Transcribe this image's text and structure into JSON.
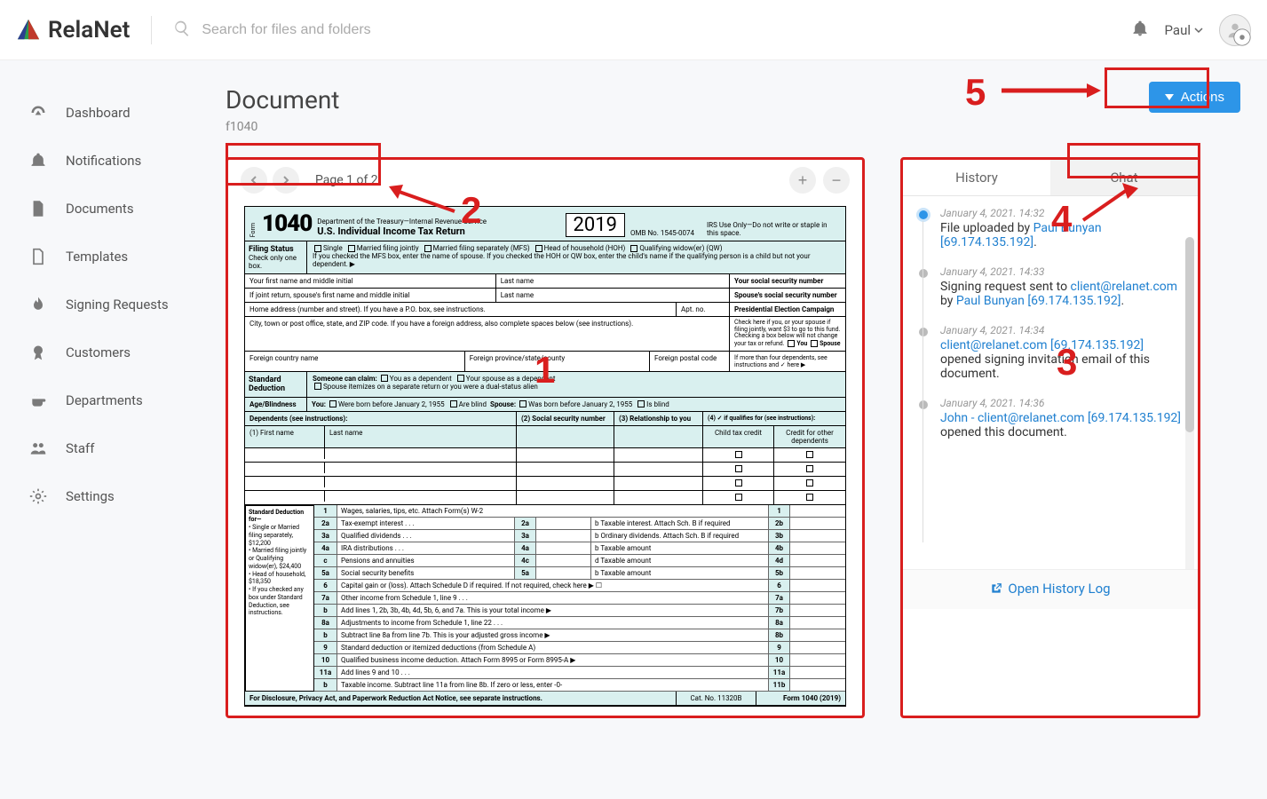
{
  "brand": "RelaNet",
  "search_placeholder": "Search for files and folders",
  "user_name": "Paul",
  "sidebar": {
    "items": [
      {
        "label": "Dashboard"
      },
      {
        "label": "Notifications"
      },
      {
        "label": "Documents"
      },
      {
        "label": "Templates"
      },
      {
        "label": "Signing Requests"
      },
      {
        "label": "Customers"
      },
      {
        "label": "Departments"
      },
      {
        "label": "Staff"
      },
      {
        "label": "Settings"
      }
    ]
  },
  "page": {
    "title": "Document",
    "subtitle": "f1040"
  },
  "actions_label": "Actions",
  "viewer": {
    "page_label": "Page 1 of 2"
  },
  "form1040": {
    "form_number_prefix": "Form",
    "form_number": "1040",
    "dept": "Department of the Treasury—Internal Revenue Service",
    "title": "U.S. Individual Income Tax Return",
    "year": "2019",
    "omb": "OMB No. 1545-0074",
    "irs_note": "IRS Use Only—Do not write or staple in this space.",
    "filing_status_label": "Filing Status",
    "filing_status_note": "Check only one box.",
    "filing_options": "Single    Married filing jointly    Married filing separately (MFS)    Head of household (HOH)    Qualifying widow(er) (QW)",
    "filing_explain": "If you checked the MFS box, enter the name of spouse. If you checked the HOH or QW box, enter the child's name if the qualifying person is a child but not your dependent. ▶",
    "first_name": "Your first name and middle initial",
    "last_name": "Last name",
    "ssn": "Your social security number",
    "spouse_first": "If joint return, spouse's first name and middle initial",
    "spouse_last": "Last name",
    "spouse_ssn": "Spouse's social security number",
    "address": "Home address (number and street). If you have a P.O. box, see instructions.",
    "apt": "Apt. no.",
    "pres_campaign": "Presidential Election Campaign",
    "pres_text": "Check here if you, or your spouse if filing jointly, want $3 to go to this fund. Checking a box below will not change your tax or refund.",
    "pres_you": "You",
    "pres_spouse": "Spouse",
    "city": "City, town or post office, state, and ZIP code. If you have a foreign address, also complete spaces below (see instructions).",
    "foreign_country": "Foreign country name",
    "foreign_prov": "Foreign province/state/county",
    "foreign_postal": "Foreign postal code",
    "more_dep": "If more than four dependents, see instructions and ✓ here ▶",
    "std_ded_label": "Standard Deduction",
    "someone_claim": "Someone can claim:",
    "you_dep": "You as a dependent",
    "spouse_dep": "Your spouse as a dependent",
    "itemize": "Spouse itemizes on a separate return or you were a dual-status alien",
    "age_blind": "Age/Blindness",
    "age_you": "You:",
    "born_before": "Were born before January 2, 1955",
    "are_blind": "Are blind",
    "age_spouse": "Spouse:",
    "was_born": "Was born before January 2, 1955",
    "is_blind": "Is blind",
    "dependents_label": "Dependents (see instructions):",
    "dep_first": "(1) First name",
    "dep_last": "Last name",
    "dep_ssn": "(2) Social security number",
    "dep_rel": "(3) Relationship to you",
    "dep_qual": "(4) ✓ if qualifies for (see instructions):",
    "dep_ctc": "Child tax credit",
    "dep_other": "Credit for other dependents",
    "ded_sidebar_title": "Standard Deduction for—",
    "ded_sidebar_1": "• Single or Married filing separately, $12,200",
    "ded_sidebar_2": "• Married filing jointly or Qualifying widow(er), $24,400",
    "ded_sidebar_3": "• Head of household, $18,350",
    "ded_sidebar_4": "• If you checked any box under Standard Deduction, see instructions.",
    "lines": [
      {
        "n": "1",
        "desc": "Wages, salaries, tips, etc. Attach Form(s) W-2",
        "box": "1"
      },
      {
        "n": "2a",
        "desc": "Tax-exempt interest . . .",
        "box": "2a",
        "desc2": "b Taxable interest. Attach Sch. B if required",
        "box2": "2b"
      },
      {
        "n": "3a",
        "desc": "Qualified dividends . . .",
        "box": "3a",
        "desc2": "b Ordinary dividends. Attach Sch. B if required",
        "box2": "3b"
      },
      {
        "n": "4a",
        "desc": "IRA distributions . . .",
        "box": "4a",
        "desc2": "b Taxable amount",
        "box2": "4b"
      },
      {
        "n": "c",
        "desc": "Pensions and annuities",
        "box": "4c",
        "desc2": "d Taxable amount",
        "box2": "4d"
      },
      {
        "n": "5a",
        "desc": "Social security benefits",
        "box": "5a",
        "desc2": "b Taxable amount",
        "box2": "5b"
      },
      {
        "n": "6",
        "desc": "Capital gain or (loss). Attach Schedule D if required. If not required, check here  ▶ ☐",
        "box": "6"
      },
      {
        "n": "7a",
        "desc": "Other income from Schedule 1, line 9 . . .",
        "box": "7a"
      },
      {
        "n": "b",
        "desc": "Add lines 1, 2b, 3b, 4b, 4d, 5b, 6, and 7a. This is your total income  ▶",
        "box": "7b"
      },
      {
        "n": "8a",
        "desc": "Adjustments to income from Schedule 1, line 22 . . .",
        "box": "8a"
      },
      {
        "n": "b",
        "desc": "Subtract line 8a from line 7b. This is your adjusted gross income  ▶",
        "box": "8b"
      },
      {
        "n": "9",
        "desc": "Standard deduction or itemized deductions (from Schedule A)",
        "box": "9"
      },
      {
        "n": "10",
        "desc": "Qualified business income deduction. Attach Form 8995 or Form 8995-A  ▶",
        "box": "10"
      },
      {
        "n": "11a",
        "desc": "Add lines 9 and 10 . . .",
        "box": "11a"
      },
      {
        "n": "b",
        "desc": "Taxable income. Subtract line 11a from line 8b. If zero or less, enter -0-",
        "box": "11b"
      }
    ],
    "disclosure": "For Disclosure, Privacy Act, and Paperwork Reduction Act Notice, see separate instructions.",
    "cat": "Cat. No. 11320B",
    "footer_form": "Form 1040 (2019)"
  },
  "tabs": {
    "history": "History",
    "chat": "Chat"
  },
  "history": [
    {
      "ts": "January 4, 2021. 14:32",
      "pre": "File uploaded by ",
      "link1": "Paul Bunyan",
      "mid": " ",
      "link2": "[69.174.135.192]",
      "post": "."
    },
    {
      "ts": "January 4, 2021. 14:33",
      "pre": "Signing request sent to ",
      "link1": "client@relanet.com",
      "mid": " by ",
      "link2": "Paul Bunyan",
      "post": " ",
      "link3": "[69.174.135.192]",
      "post2": "."
    },
    {
      "ts": "January 4, 2021. 14:34",
      "pre": "",
      "link1": "client@relanet.com",
      "mid": " ",
      "link2": "[69.174.135.192]",
      "post": " opened signing invitation email of this document."
    },
    {
      "ts": "January 4, 2021. 14:36",
      "pre": "",
      "link1": "John - client@relanet.com",
      "mid": " ",
      "link2": "[69.174.135.192]",
      "post": " opened this document."
    }
  ],
  "history_footer": "Open History Log",
  "annotations": {
    "n1": "1",
    "n2": "2",
    "n3": "3",
    "n4": "4",
    "n5": "5"
  }
}
